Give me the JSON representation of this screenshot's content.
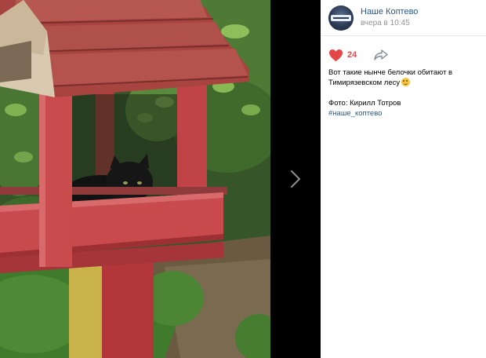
{
  "post": {
    "author": "Наше Коптево",
    "time": "вчера в 10:45",
    "likes": "24",
    "text_line": "Вот такие нынче белочки обитают в Тимирязевском лесу",
    "credit": "Фото: Кирилл Тотров",
    "hashtag": "#наше_коптево"
  },
  "icons": {
    "like": "heart-icon",
    "share": "share-arrow-icon",
    "next": "chevron-right-icon",
    "emoji": "grinning-face-emoji"
  },
  "colors": {
    "link": "#2a5885",
    "like": "#e64646",
    "muted": "#939393",
    "viewer_bg": "#000000"
  }
}
